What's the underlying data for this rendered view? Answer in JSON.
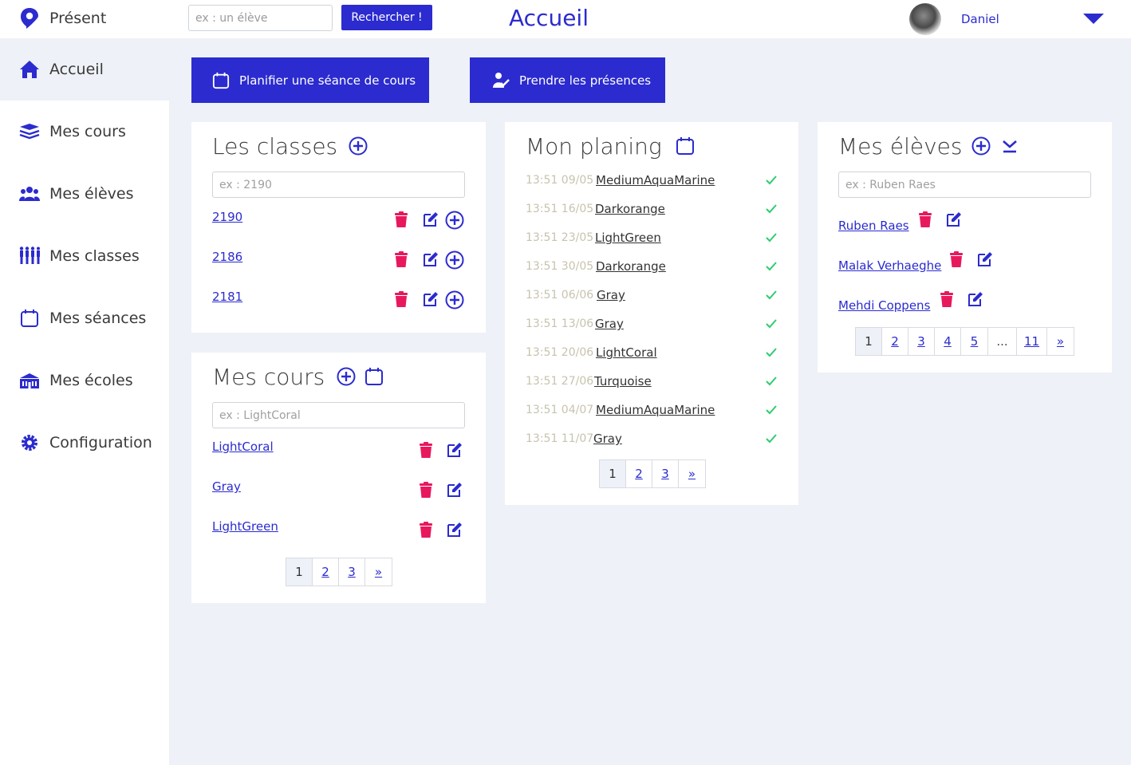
{
  "app": {
    "brand": "Présent",
    "page_title": "Accueil"
  },
  "header": {
    "search_placeholder": "ex : un élève",
    "search_button": "Rechercher !",
    "username": "Daniel"
  },
  "sidebar": {
    "items": [
      {
        "label": "Accueil",
        "icon": "home-icon"
      },
      {
        "label": "Mes cours",
        "icon": "stack-icon"
      },
      {
        "label": "Mes élèves",
        "icon": "users-icon"
      },
      {
        "label": "Mes classes",
        "icon": "class-icon"
      },
      {
        "label": "Mes séances",
        "icon": "calendar-icon"
      },
      {
        "label": "Mes écoles",
        "icon": "school-icon"
      },
      {
        "label": "Configuration",
        "icon": "gear-icon"
      }
    ],
    "active": "Accueil"
  },
  "actions": {
    "plan_session": "Planifier une séance de cours",
    "take_attendance": "Prendre les présences"
  },
  "classes": {
    "title": "Les classes",
    "placeholder": "ex : 2190",
    "items": [
      "2190",
      "2186",
      "2181"
    ]
  },
  "courses": {
    "title": "Mes cours",
    "placeholder": "ex : LightCoral",
    "items": [
      "LightCoral",
      "Gray",
      "LightGreen"
    ],
    "pages": [
      "1",
      "2",
      "3",
      "»"
    ]
  },
  "planning": {
    "title": "Mon planing",
    "items": [
      {
        "time": "13:51 09/05",
        "course": "MediumAquaMarine"
      },
      {
        "time": "13:51 16/05",
        "course": "Darkorange"
      },
      {
        "time": "13:51 23/05",
        "course": "LightGreen"
      },
      {
        "time": "13:51 30/05",
        "course": "Darkorange"
      },
      {
        "time": "13:51 06/06",
        "course": "Gray"
      },
      {
        "time": "13:51 13/06",
        "course": "Gray"
      },
      {
        "time": "13:51 20/06",
        "course": "LightCoral"
      },
      {
        "time": "13:51 27/06",
        "course": "Turquoise"
      },
      {
        "time": "13:51 04/07",
        "course": "MediumAquaMarine"
      },
      {
        "time": "13:51 11/07",
        "course": "Gray"
      }
    ],
    "pages": [
      "1",
      "2",
      "3",
      "»"
    ]
  },
  "students": {
    "title": "Mes élèves",
    "placeholder": "ex : Ruben Raes",
    "items": [
      "Ruben Raes",
      "Malak Verhaeghe",
      "Mehdi Coppens"
    ],
    "pages": [
      "1",
      "2",
      "3",
      "4",
      "5",
      "...",
      "11",
      "»"
    ]
  },
  "colors": {
    "accent": "#2b2bcf",
    "delete": "#e8185c",
    "check": "#2ecc71",
    "background": "#eef1f7"
  }
}
